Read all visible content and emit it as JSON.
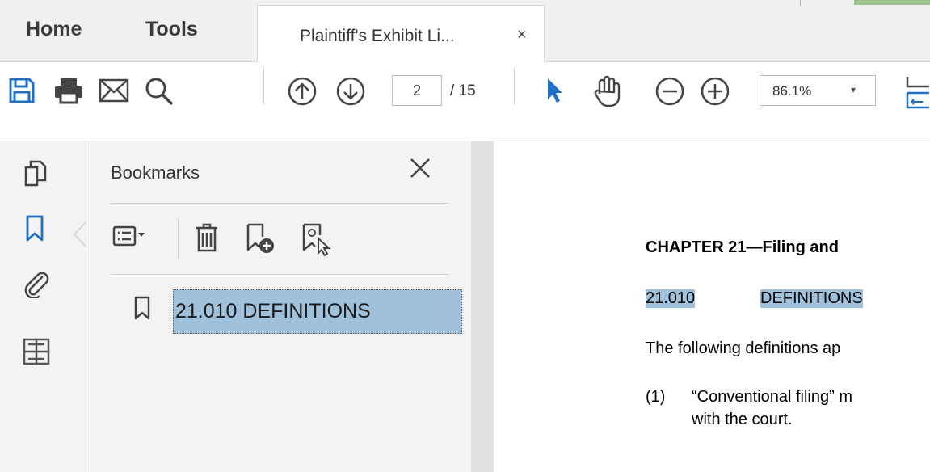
{
  "topbar": {
    "home_label": "Home",
    "tools_label": "Tools",
    "doc_tab_label": "Plaintiff's Exhibit Li...",
    "doc_tab_close": "×"
  },
  "toolbar": {
    "page_current": "2",
    "page_total": "/ 15",
    "zoom_value": "86.1%",
    "zoom_caret": "▾",
    "icons": [
      "save-icon",
      "print-icon",
      "email-icon",
      "search-icon",
      "page-up-icon",
      "page-down-icon",
      "select-arrow-icon",
      "hand-tool-icon",
      "zoom-out-icon",
      "zoom-in-icon",
      "fit-page-icon"
    ]
  },
  "rail": {
    "icons": [
      "pages-icon",
      "bookmark-icon",
      "attachment-icon",
      "layers-icon"
    ]
  },
  "bookmarks": {
    "title": "Bookmarks",
    "items": [
      {
        "label": "21.010 DEFINITIONS"
      }
    ],
    "icons": [
      "options-menu-icon",
      "delete-icon",
      "new-bookmark-icon",
      "bookmark-from-selection-icon",
      "close-icon"
    ]
  },
  "document": {
    "chapter": "CHAPTER 21—Filing and",
    "section_number": "21.010",
    "section_title": "DEFINITIONS",
    "paragraph": "The following definitions ap",
    "list_item_number": "(1)",
    "list_item_line1": "“Conventional filing” m",
    "list_item_line2": "with the court."
  },
  "colors": {
    "accent_blue": "#1f6fc5",
    "selection_blue": "#9fc1dc",
    "chrome_gray": "#f0f0f0"
  }
}
